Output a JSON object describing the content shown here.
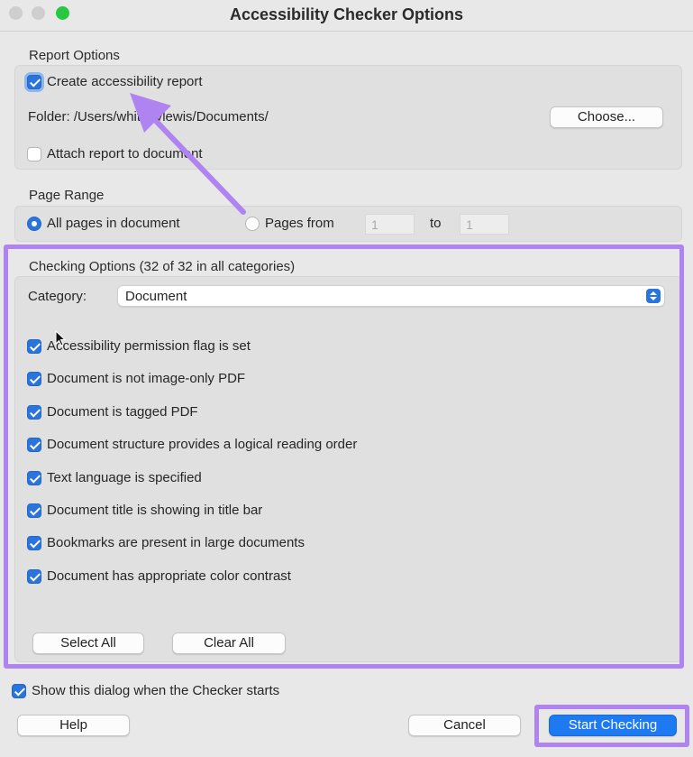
{
  "window": {
    "title": "Accessibility Checker Options",
    "traffic_lights": [
      "#cfcecf",
      "#cfcecf",
      "#28c840"
    ]
  },
  "report_options": {
    "label": "Report Options",
    "create_report": {
      "label": "Create accessibility report",
      "checked": true
    },
    "folder_text": "Folder: /Users/whitneylewis/Documents/",
    "choose_button": "Choose...",
    "attach_report": {
      "label": "Attach report to document",
      "checked": false
    }
  },
  "page_range": {
    "label": "Page Range",
    "all_pages": {
      "label": "All pages in document",
      "selected": true
    },
    "pages_from": {
      "label": "Pages from",
      "selected": false,
      "from_value": "1",
      "to_label": "to",
      "to_value": "1"
    }
  },
  "checking_options": {
    "label": "Checking Options (32 of 32 in all categories)",
    "category_label": "Category:",
    "category_value": "Document",
    "items": [
      {
        "label": "Accessibility permission flag is set",
        "checked": true
      },
      {
        "label": "Document is not image-only PDF",
        "checked": true
      },
      {
        "label": "Document is tagged PDF",
        "checked": true
      },
      {
        "label": "Document structure provides a logical reading order",
        "checked": true
      },
      {
        "label": "Text language is specified",
        "checked": true
      },
      {
        "label": "Document title is showing in title bar",
        "checked": true
      },
      {
        "label": "Bookmarks are present in large documents",
        "checked": true
      },
      {
        "label": "Document has appropriate color contrast",
        "checked": true
      }
    ],
    "select_all": "Select All",
    "clear_all": "Clear All"
  },
  "footer": {
    "show_dialog": {
      "label": "Show this dialog when the Checker starts",
      "checked": true
    },
    "help": "Help",
    "cancel": "Cancel",
    "start": "Start Checking"
  },
  "colors": {
    "accent": "#1d7af0",
    "highlight": "#b084f0"
  }
}
